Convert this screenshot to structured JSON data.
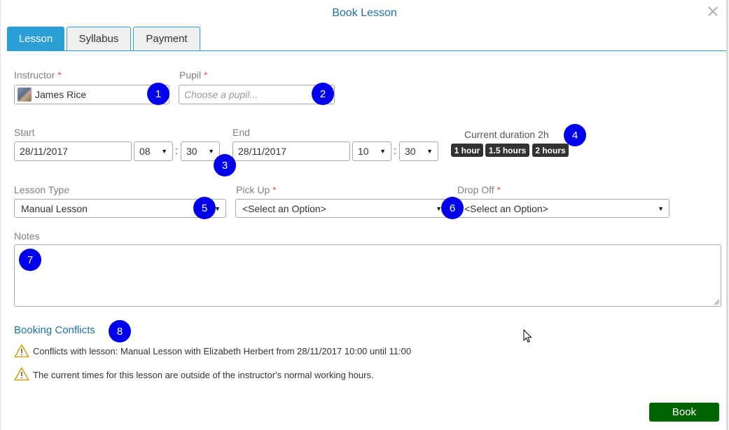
{
  "dialog": {
    "title": "Book Lesson",
    "close_glyph": "✕"
  },
  "tabs": [
    {
      "label": "Lesson",
      "active": true
    },
    {
      "label": "Syllabus",
      "active": false
    },
    {
      "label": "Payment",
      "active": false
    }
  ],
  "instructor": {
    "label": "Instructor",
    "required_mark": "*",
    "value": "James Rice",
    "icon": "instructor-avatar"
  },
  "pupil": {
    "label": "Pupil",
    "required_mark": "*",
    "placeholder": "Choose a pupil..."
  },
  "start": {
    "label": "Start",
    "date": "28/11/2017",
    "hour": "08",
    "minute": "30"
  },
  "end": {
    "label": "End",
    "date": "28/11/2017",
    "hour": "10",
    "minute": "30"
  },
  "time_separator": ":",
  "duration": {
    "text": "Current duration 2h",
    "presets": [
      "1 hour",
      "1.5 hours",
      "2 hours"
    ]
  },
  "lesson_type": {
    "label": "Lesson Type",
    "value": "Manual Lesson"
  },
  "pick_up": {
    "label": "Pick Up",
    "required_mark": "*",
    "value": "<Select an Option>"
  },
  "drop_off": {
    "label": "Drop Off",
    "required_mark": "*",
    "value": "<Select an Option>"
  },
  "notes": {
    "label": "Notes",
    "value": ""
  },
  "conflicts": {
    "heading": "Booking Conflicts",
    "items": [
      "Conflicts with lesson: Manual Lesson with Elizabeth Herbert from 28/11/2017 10:00 until 11:00",
      "The current times for this lesson are outside of the instructor's normal working hours."
    ]
  },
  "annotations": [
    "1",
    "2",
    "3",
    "4",
    "5",
    "6",
    "7",
    "8"
  ],
  "actions": {
    "book_label": "Book"
  },
  "colors": {
    "accent": "#2a9fd6",
    "title": "#1d73a8",
    "required": "#d9534f",
    "badge_bg": "#333333",
    "annotation_marker": "#0000ee",
    "warning": "#d4a017",
    "book_button": "#006400"
  }
}
